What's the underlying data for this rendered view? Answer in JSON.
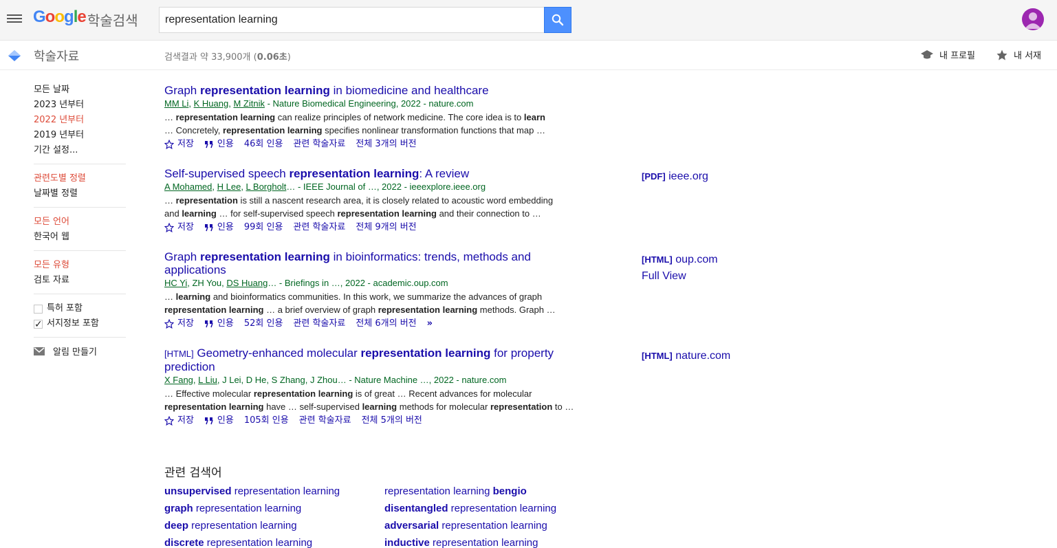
{
  "header": {
    "logo_letters": [
      "G",
      "o",
      "o",
      "g",
      "l",
      "e"
    ],
    "logo_sub": "학술검색",
    "search_value": "representation learning"
  },
  "subbar": {
    "title": "학술자료",
    "count_prefix": "검색결과 약 33,900개 (",
    "count_time": "0.06초",
    "count_suffix": ")",
    "profile_label": "내 프로필",
    "library_label": "내 서재"
  },
  "sidebar": {
    "dates": [
      "모든 날짜",
      "2023 년부터",
      "2022 년부터",
      "2019 년부터",
      "기간 설정..."
    ],
    "active_date_index": 2,
    "sort": [
      "관련도별 정렬",
      "날짜별 정렬"
    ],
    "languages": [
      "모든 언어",
      "한국어 웹"
    ],
    "types": [
      "모든 유형",
      "검토 자료"
    ],
    "checks": [
      {
        "label": "특허 포함",
        "checked": false
      },
      {
        "label": "서지정보 포함",
        "checked": true
      }
    ],
    "alert_label": "알림 만들기"
  },
  "results": [
    {
      "title_parts": [
        {
          "t": "Graph ",
          "b": false
        },
        {
          "t": "representation learning",
          "b": true
        },
        {
          "t": " in biomedicine and healthcare",
          "b": false
        }
      ],
      "authors_linked": [
        "MM Li",
        "K Huang",
        "M Zitnik"
      ],
      "authors_plain": "",
      "source": " - Nature Biomedical Engineering, 2022 - nature.com",
      "snippet_lines": [
        [
          {
            "t": "… ",
            "b": false
          },
          {
            "t": "representation learning",
            "b": true
          },
          {
            "t": " can realize principles of network medicine. The core idea is to ",
            "b": false
          },
          {
            "t": "learn",
            "b": true
          }
        ],
        [
          {
            "t": "… Concretely, ",
            "b": false
          },
          {
            "t": "representation learning",
            "b": true
          },
          {
            "t": " specifies nonlinear transformation functions that map …",
            "b": false
          }
        ]
      ],
      "save": "저장",
      "cite": "인용",
      "cited_by": "46회 인용",
      "related": "관련 학술자료",
      "versions": "전체 3개의 버전",
      "side_links": []
    },
    {
      "title_parts": [
        {
          "t": "Self-supervised speech ",
          "b": false
        },
        {
          "t": "representation learning",
          "b": true
        },
        {
          "t": ": A review",
          "b": false
        }
      ],
      "authors_linked": [
        "A Mohamed",
        "H Lee",
        "L Borgholt"
      ],
      "authors_plain": "",
      "source": "… - IEEE Journal of …, 2022 - ieeexplore.ieee.org",
      "snippet_lines": [
        [
          {
            "t": "… ",
            "b": false
          },
          {
            "t": "representation",
            "b": true
          },
          {
            "t": " is still a nascent research area, it is closely related to acoustic word embedding",
            "b": false
          }
        ],
        [
          {
            "t": "and ",
            "b": false
          },
          {
            "t": "learning",
            "b": true
          },
          {
            "t": " … for self-supervised speech ",
            "b": false
          },
          {
            "t": "representation learning",
            "b": true
          },
          {
            "t": " and their connection to …",
            "b": false
          }
        ]
      ],
      "save": "저장",
      "cite": "인용",
      "cited_by": "99회 인용",
      "related": "관련 학술자료",
      "versions": "전체 9개의 버전",
      "side_links": [
        {
          "fmt": "[PDF]",
          "text": " ieee.org"
        }
      ]
    },
    {
      "title_parts": [
        {
          "t": "Graph ",
          "b": false
        },
        {
          "t": "representation learning",
          "b": true
        },
        {
          "t": " in bioinformatics: trends, methods and applications",
          "b": false
        }
      ],
      "authors_linked": [
        "HC Yi"
      ],
      "authors_plain": ", ZH You, ",
      "authors_linked2": [
        "DS Huang"
      ],
      "source": "… - Briefings in …, 2022 - academic.oup.com",
      "snippet_lines": [
        [
          {
            "t": "… ",
            "b": false
          },
          {
            "t": "learning",
            "b": true
          },
          {
            "t": " and bioinformatics communities. In this work, we summarize the advances of graph",
            "b": false
          }
        ],
        [
          {
            "t": "representation learning",
            "b": true
          },
          {
            "t": " … a brief overview of graph ",
            "b": false
          },
          {
            "t": "representation learning",
            "b": true
          },
          {
            "t": " methods. Graph …",
            "b": false
          }
        ]
      ],
      "save": "저장",
      "cite": "인용",
      "cited_by": "52회 인용",
      "related": "관련 학술자료",
      "versions": "전체 6개의 버전",
      "more": "»",
      "side_links": [
        {
          "fmt": "[HTML]",
          "text": " oup.com"
        },
        {
          "fmt": "",
          "text": "Full View"
        }
      ]
    },
    {
      "tag": "[HTML]",
      "title_parts": [
        {
          "t": " Geometry-enhanced molecular ",
          "b": false
        },
        {
          "t": "representation learning",
          "b": true
        },
        {
          "t": " for property prediction",
          "b": false
        }
      ],
      "authors_linked": [
        "X Fang",
        "L Liu"
      ],
      "authors_plain": ", J Lei, D He, S Zhang, J Zhou",
      "source": "… - Nature Machine …, 2022 - nature.com",
      "snippet_lines": [
        [
          {
            "t": "… Effective molecular ",
            "b": false
          },
          {
            "t": "representation learning",
            "b": true
          },
          {
            "t": " is of great … Recent advances for molecular",
            "b": false
          }
        ],
        [
          {
            "t": "representation learning",
            "b": true
          },
          {
            "t": " have … self-supervised ",
            "b": false
          },
          {
            "t": "learning",
            "b": true
          },
          {
            "t": " methods for molecular ",
            "b": false
          },
          {
            "t": "representation",
            "b": true
          },
          {
            "t": " to …",
            "b": false
          }
        ]
      ],
      "save": "저장",
      "cite": "인용",
      "cited_by": "105회 인용",
      "related": "관련 학술자료",
      "versions": "전체 5개의 버전",
      "side_links": [
        {
          "fmt": "[HTML]",
          "text": " nature.com"
        }
      ]
    }
  ],
  "related_searches": {
    "title": "관련 검색어",
    "items": [
      {
        "bold": "unsupervised",
        "rest": " representation learning",
        "bold_first": true
      },
      {
        "bold": "bengio",
        "rest": "representation learning ",
        "bold_first": false
      },
      {
        "bold": "graph",
        "rest": " representation learning",
        "bold_first": true
      },
      {
        "bold": "disentangled",
        "rest": " representation learning",
        "bold_first": true
      },
      {
        "bold": "deep",
        "rest": " representation learning",
        "bold_first": true
      },
      {
        "bold": "adversarial",
        "rest": " representation learning",
        "bold_first": true
      },
      {
        "bold": "discrete",
        "rest": " representation learning",
        "bold_first": true
      },
      {
        "bold": "inductive",
        "rest": " representation learning",
        "bold_first": true
      }
    ]
  },
  "colors": {
    "link": "#1a0dab",
    "source_green": "#006621",
    "active_red": "#dd4b39",
    "search_blue": "#4d90fe"
  }
}
